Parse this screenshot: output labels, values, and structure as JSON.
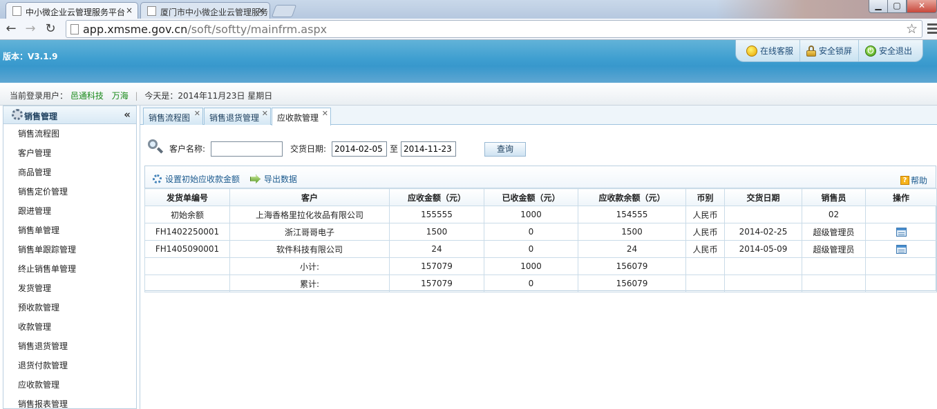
{
  "browser": {
    "tabs": [
      {
        "title": "中小微企业云管理服务平台",
        "active": true
      },
      {
        "title": "厦门市中小微企业云管理服务",
        "active": false
      }
    ],
    "close_glyph": "×",
    "url_host": "app.xmsme.gov.cn",
    "url_path": "/soft/softty/mainfrm.aspx",
    "window_controls": {
      "minimize": "▁",
      "maximize": "▢",
      "close": "✕"
    }
  },
  "header": {
    "version": "版本：V3.1.9",
    "topnav": [
      {
        "label": "在线客服",
        "icon": "smile-icon"
      },
      {
        "label": "安全锁屏",
        "icon": "lock-icon"
      },
      {
        "label": "安全退出",
        "icon": "power-icon"
      }
    ]
  },
  "status": {
    "user_label": "当前登录用户：",
    "company": "邑通科技",
    "user": "万海",
    "separator": "|",
    "today": "今天是：2014年11月23日 星期日"
  },
  "sidebar": {
    "title": "销售管理",
    "collapse_glyph": "«",
    "items": [
      "销售流程图",
      "客户管理",
      "商品管理",
      "销售定价管理",
      "跟进管理",
      "销售单管理",
      "销售单跟踪管理",
      "终止销售单管理",
      "发货管理",
      "预收款管理",
      "收款管理",
      "销售退货管理",
      "退货付款管理",
      "应收款管理",
      "销售报表管理"
    ]
  },
  "content_tabs": [
    {
      "label": "销售流程图",
      "active": false
    },
    {
      "label": "销售退货管理",
      "active": false
    },
    {
      "label": "应收款管理",
      "active": true
    }
  ],
  "search": {
    "customer_label": "客户名称:",
    "customer_value": "",
    "date_label": "交货日期:",
    "date_from": "2014-02-05",
    "to_label": "至",
    "date_to": "2014-11-23",
    "query_button": "查询"
  },
  "grid": {
    "actions": {
      "set_initial": "设置初始应收款金额",
      "export": "导出数据",
      "help": "帮助"
    },
    "columns": [
      "发货单编号",
      "客户",
      "应收金额（元）",
      "已收金额（元）",
      "应收款余额（元）",
      "币别",
      "交货日期",
      "销售员",
      "操作"
    ],
    "rows": [
      [
        "初始余额",
        "上海香格里拉化妆品有限公司",
        "155555",
        "1000",
        "154555",
        "人民币",
        "",
        "02",
        ""
      ],
      [
        "FH1402250001",
        "浙江哥哥电子",
        "1500",
        "0",
        "1500",
        "人民币",
        "2014-02-25",
        "超级管理员",
        "op"
      ],
      [
        "FH1405090001",
        "软件科技有限公司",
        "24",
        "0",
        "24",
        "人民币",
        "2014-05-09",
        "超级管理员",
        "op"
      ],
      [
        "",
        "小计:",
        "157079",
        "1000",
        "156079",
        "",
        "",
        "",
        ""
      ],
      [
        "",
        "累计:",
        "157079",
        "0",
        "156079",
        "",
        "",
        "",
        ""
      ]
    ]
  }
}
